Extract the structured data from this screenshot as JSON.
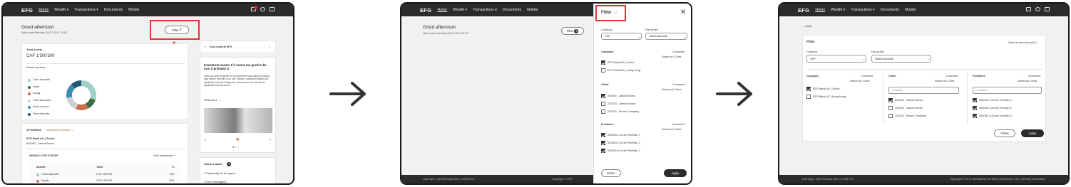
{
  "nav": {
    "logo": "EFG",
    "items": [
      "Home",
      "Wealth ▾",
      "Transactions ▾",
      "Documents",
      "Mobile"
    ],
    "notif_count": "1"
  },
  "dashboard": {
    "greeting": "Good afternoon",
    "value_date": "Value date Monday, 05.02.2024 13:52",
    "filter_label": "Filter",
    "total_assets_title": "Total Assets",
    "total_assets_value": "CHF 1'500'300",
    "assets_by_class": "Assets by class",
    "asset_classes": [
      {
        "label": "Cash deposits",
        "color": "#9ecfc6"
      },
      {
        "label": "Other",
        "color": "#3b6e3e"
      },
      {
        "label": "Equity",
        "color": "#c8704e"
      },
      {
        "label": "Cash Accounts",
        "color": "#cfd0d0"
      },
      {
        "label": "Fixed income",
        "color": "#3d8db0"
      },
      {
        "label": "Time deposits",
        "color": "#27557a"
      }
    ],
    "portfolios_title": "3 Portfolios",
    "investment_structure": "Investment structure →",
    "bank": "EFG Bank AG | Zurich",
    "client_line": "540000 - James Brown",
    "portfolio_line": "540000-1  CHF 0'10'000",
    "hide_breakdown": "Hide breakdown ^",
    "table_headers": [
      "Assets",
      "Total",
      "%"
    ],
    "table_rows": [
      [
        "Cash deposits",
        "CHF 100'000",
        "73%"
      ],
      [
        "Equity",
        "CHF 100'000",
        "15%"
      ]
    ],
    "team_title": "Your team at EFG",
    "article_title": "Investment scams: If it seems too good to be true, it probably is",
    "article_body": "Have you seen an advert for an investment opportunity promising high returns with little or no risk? Beware: investment scams are fraudulent schemes designed to deceive you and can lead to significant financial losses.",
    "read_more": "Read more →",
    "alerts_title": "Alerts & tasks",
    "alerts_count": "3",
    "alert_1": "2 Payment(s) to be signed",
    "alert_2": "3 New message(s)"
  },
  "filter_panel": {
    "title": "Filter",
    "greeting": "Good afternoon",
    "value_date": "Value date Monday, 05.02.2024 13:52",
    "filter_label": "Filter",
    "filter_count": "3",
    "currency_label": "Currency",
    "currency_value": "CHF",
    "favourites_label": "Favourites",
    "favourites_value": "Select favourite",
    "company_title": "Company",
    "company_selected": "1 selected",
    "client_title": "Client",
    "client_selected": "1 selected",
    "portfolios_title": "Portfolios",
    "portfolios_selected": "3 selected",
    "select_all": "Select all",
    "clear": "Clear",
    "companies": [
      "EFG Bank AG | Zurich",
      "EFG Bank AG | Hong Kong"
    ],
    "clients": [
      "540000 - James Brown",
      "222200 - James Brown",
      "222333 - Brown Company"
    ],
    "portfolios": [
      "540000-1 Zurich Portfolio 1",
      "540000-2 Zurich Portfolio 2",
      "540000-3 Zurich Portfolio 3"
    ],
    "close": "Close",
    "apply": "Apply",
    "footer_left": "Last login: 13th February 2024 | 13:08 UTC",
    "footer_right": "Copyright © EFG"
  },
  "filter_page": {
    "back": "← Back",
    "title": "Filter",
    "save_fav": "Save as new favourite",
    "search": "Search",
    "footer_left": "Last login: 13th February 2024 | 13:08 UTC",
    "footer_right": "Copyright © EFG International. All Rights Reserved  |  T&C  |  Security information"
  },
  "colors": {
    "highlight": "#e0343a",
    "nav": "#2b2b2b"
  }
}
